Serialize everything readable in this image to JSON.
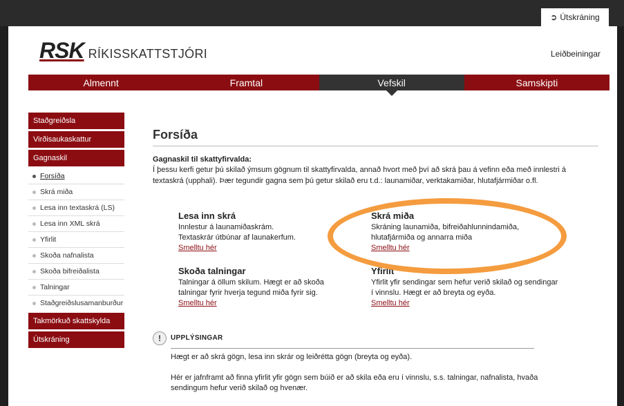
{
  "header": {
    "logout_label": "Útskráning",
    "logout_icon": "sign-out-icon",
    "logo_short": "RSK",
    "logo_full": "RÍKISSKATTSTJÓRI",
    "help_link": "Leiðbeiningar"
  },
  "colors": {
    "brand": "#8b0d12",
    "nav_active": "#333333",
    "highlight": "#f49c3f"
  },
  "nav": {
    "tabs": [
      "Almennt",
      "Framtal",
      "Vefskil",
      "Samskipti"
    ],
    "active": "Vefskil"
  },
  "sidebar": {
    "sections": [
      "Staðgreiðsla",
      "Virðisaukaskattur",
      "Gagnaskil"
    ],
    "items": [
      "Forsíða",
      "Skrá miða",
      "Lesa inn textaskrá (LS)",
      "Lesa inn XML skrá",
      "Yfirlit",
      "Skoða nafnalista",
      "Skoða bifreiðalista",
      "Talningar",
      "Staðgreiðslusamanburður"
    ],
    "active_item": "Forsíða",
    "bottom_sections": [
      "Takmörkuð skattskylda",
      "Útskráning"
    ]
  },
  "main": {
    "title": "Forsíða",
    "intro_heading": "Gagnaskil til skattyfirvalda:",
    "intro_text": "Í þessu kerfi getur þú skilað ýmsum gögnum til skattyfirvalda, annað hvort með því að skrá þau á vefinn eða með innlestri á textaskrá (upphali). Þær tegundir gagna sem þú getur skilað eru t.d.: launamiðar, verktakamiðar, hlutafjármiðar o.fl.",
    "cards": [
      {
        "title": "Lesa inn skrá",
        "lines": [
          "Innlestur á launamiðaskrám.",
          "Textaskrár útbúnar af launakerfum."
        ],
        "link": "Smelltu hér"
      },
      {
        "title": "Skrá miða",
        "lines": [
          "Skráning launamiða, bifreiðahlunnindamiða,",
          "hlutafjármiða og annarra miða"
        ],
        "link": "Smelltu hér"
      },
      {
        "title": "Skoða talningar",
        "lines": [
          "Talningar á öllum skilum.  Hægt er að skoða",
          "talningar fyrir hverja tegund miða fyrir sig."
        ],
        "link": "Smelltu hér"
      },
      {
        "title": "Yfirlit",
        "lines": [
          "Yfirlit yfir sendingar sem hefur verið skilað og sendingar",
          "í vinnslu.  Hægt er að breyta og eyða."
        ],
        "link": "Smelltu hér"
      }
    ],
    "info": {
      "icon": "exclamation-icon",
      "heading": "UPPLÝSINGAR",
      "p1": "Hægt er að skrá gögn, lesa inn skrár og leiðrétta gögn (breyta og eyða).",
      "p2": "Hér er jafnframt að finna yfirlit yfir gögn sem búið er að skila eða eru í vinnslu, s.s. talningar, nafnalista, hvaða sendingum hefur verið skilað og hvenær."
    }
  }
}
